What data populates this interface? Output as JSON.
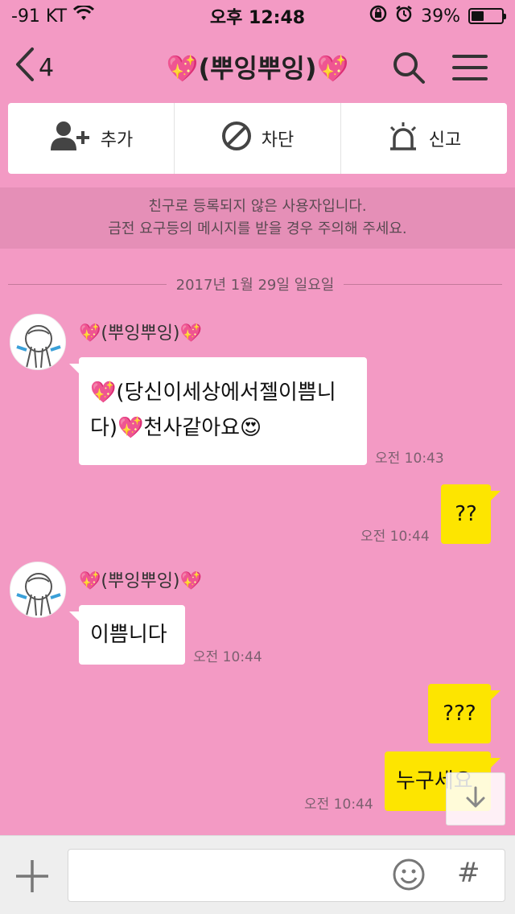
{
  "status_bar": {
    "carrier": "-91 KT",
    "time": "오후 12:48",
    "battery": "39%",
    "battery_level": 0.39
  },
  "nav": {
    "back_count": "4",
    "title": "💖(뿌잉뿌잉)💖"
  },
  "actions": {
    "add_label": "추가",
    "block_label": "차단",
    "report_label": "신고"
  },
  "warning": {
    "line1": "친구로 등록되지 않은 사용자입니다.",
    "line2": "금전 요구등의 메시지를 받을 경우 주의해 주세요."
  },
  "date_divider": "2017년 1월 29일 일요일",
  "messages": [
    {
      "sender": "💖(뿌잉뿌잉)💖",
      "text_line1": "💖(당신이세상에서젤이쁨니",
      "text_line2": "다)💖천사같아요😍",
      "time": "오전 10:43"
    },
    {
      "text": "??",
      "time": "오전 10:44"
    },
    {
      "sender": "💖(뿌잉뿌잉)💖",
      "text": "이쁨니다",
      "time": "오전 10:44"
    },
    {
      "text": "???"
    },
    {
      "text": "누구세요",
      "time": "오전 10:44"
    }
  ],
  "input": {
    "placeholder": "",
    "hash": "#"
  }
}
